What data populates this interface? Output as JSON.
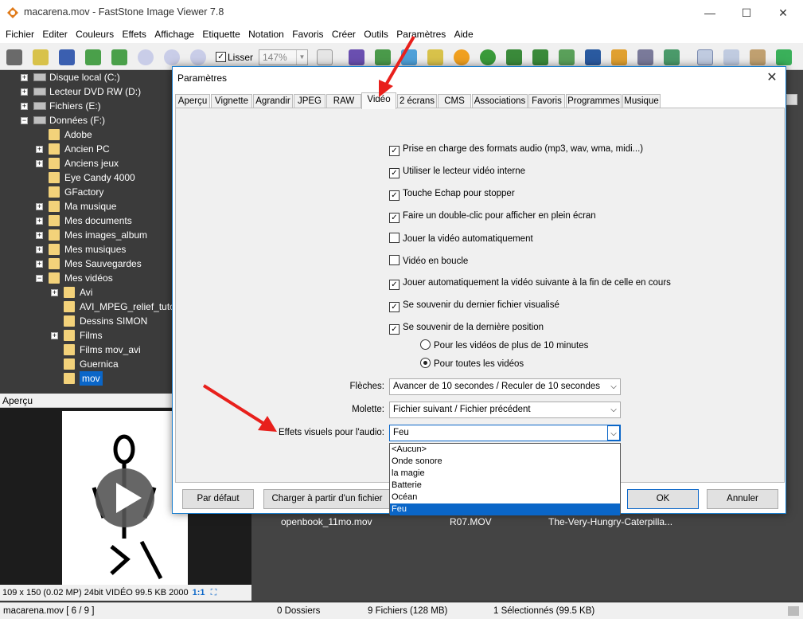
{
  "window": {
    "title": "macarena.mov - FastStone Image Viewer 7.8",
    "minimize": "—",
    "maximize": "☐",
    "close": "✕"
  },
  "menu": [
    "Fichier",
    "Editer",
    "Couleurs",
    "Effets",
    "Affichage",
    "Etiquette",
    "Notation",
    "Favoris",
    "Créer",
    "Outils",
    "Paramètres",
    "Aide"
  ],
  "toolbar": {
    "smooth_label": "Lisser",
    "smooth_checked": "✓",
    "zoom_value": "147%"
  },
  "tree": [
    {
      "label": "Disque local (C:)",
      "type": "drive",
      "expand": "+"
    },
    {
      "label": "Lecteur DVD RW (D:)",
      "type": "drive",
      "expand": "+"
    },
    {
      "label": "Fichiers (E:)",
      "type": "drive",
      "expand": "+"
    },
    {
      "label": "Données (F:)",
      "type": "drive",
      "expand": "−"
    },
    {
      "label": "Adobe",
      "type": "folder",
      "expand": ""
    },
    {
      "label": "Ancien PC",
      "type": "folder",
      "expand": "+"
    },
    {
      "label": "Anciens jeux",
      "type": "folder",
      "expand": "+"
    },
    {
      "label": "Eye Candy 4000",
      "type": "folder",
      "expand": ""
    },
    {
      "label": "GFactory",
      "type": "folder",
      "expand": ""
    },
    {
      "label": "Ma musique",
      "type": "folder",
      "expand": "+"
    },
    {
      "label": "Mes documents",
      "type": "folder",
      "expand": "+"
    },
    {
      "label": "Mes images_album",
      "type": "folder",
      "expand": "+"
    },
    {
      "label": "Mes musiques",
      "type": "folder",
      "expand": "+"
    },
    {
      "label": "Mes Sauvegardes",
      "type": "folder",
      "expand": "+"
    },
    {
      "label": "Mes vidéos",
      "type": "folder",
      "expand": "−"
    },
    {
      "label": "Avi",
      "type": "folder",
      "expand": "+"
    },
    {
      "label": "AVI_MPEG_relief_tutos",
      "type": "folder",
      "expand": ""
    },
    {
      "label": "Dessins SIMON",
      "type": "folder",
      "expand": ""
    },
    {
      "label": "Films",
      "type": "folder",
      "expand": "+"
    },
    {
      "label": "Films mov_avi",
      "type": "folder",
      "expand": ""
    },
    {
      "label": "Guernica",
      "type": "folder",
      "expand": ""
    },
    {
      "label": "mov",
      "type": "folder",
      "expand": "",
      "selected": true
    }
  ],
  "preview": {
    "header": "Aperçu",
    "info": "109 x 150 (0.02 MP)  24bit  VIDÉO  99.5 KB  2000",
    "ratio": "1:1"
  },
  "browser": {
    "files": [
      "openbook_11mo.mov",
      "R07.MOV",
      "The-Very-Hungry-Caterpilla..."
    ]
  },
  "status": {
    "file": "macarena.mov [ 6 / 9 ]",
    "folders": "0 Dossiers",
    "files": "9 Fichiers (128 MB)",
    "selected": "1 Sélectionnés (99.5 KB)"
  },
  "dialog": {
    "title": "Paramètres",
    "tabs": [
      "Aperçu",
      "Vignette",
      "Agrandir",
      "JPEG",
      "RAW",
      "Vidéo",
      "2 écrans",
      "CMS",
      "Associations",
      "Favoris",
      "Programmes",
      "Musique"
    ],
    "active_tab": "Vidéo",
    "options": [
      {
        "label": "Prise en charge des formats audio (mp3, wav, wma, midi...)",
        "checked": true
      },
      {
        "label": "Utiliser le lecteur vidéo interne",
        "checked": true
      },
      {
        "label": "Touche Echap pour stopper",
        "checked": true
      },
      {
        "label": "Faire un double-clic pour afficher en plein écran",
        "checked": true
      },
      {
        "label": "Jouer la vidéo automatiquement",
        "checked": false
      },
      {
        "label": "Vidéo en boucle",
        "checked": false
      },
      {
        "label": "Jouer automatiquement la vidéo suivante à la fin de celle en cours",
        "checked": true
      },
      {
        "label": "Se souvenir du dernier fichier visualisé",
        "checked": true
      },
      {
        "label": "Se souvenir de la dernière position",
        "checked": true
      }
    ],
    "radios": [
      {
        "label": "Pour les vidéos de plus de 10 minutes",
        "selected": false
      },
      {
        "label": "Pour toutes les vidéos",
        "selected": true
      }
    ],
    "arrows_label": "Flèches:",
    "arrows_value": "Avancer de 10 secondes / Reculer de 10 secondes",
    "wheel_label": "Molette:",
    "wheel_value": "Fichier suivant / Fichier précédent",
    "audio_fx_label": "Effets visuels pour l'audio:",
    "audio_fx_value": "Feu",
    "audio_fx_options": [
      "<Aucun>",
      "Onde sonore",
      "la magie",
      "Batterie",
      "Océan",
      "Feu"
    ],
    "btn_default": "Par défaut",
    "btn_load": "Charger à partir d'un fichier",
    "btn_ok": "OK",
    "btn_cancel": "Annuler"
  },
  "colors": {
    "accent": "#0a66c8",
    "annotation_arrow": "#e8201c"
  }
}
